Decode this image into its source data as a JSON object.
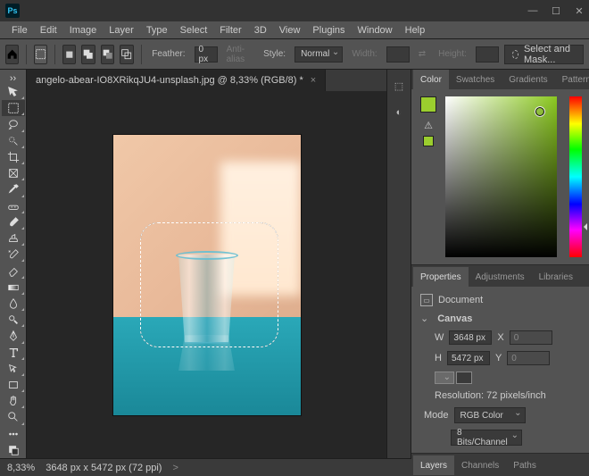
{
  "menubar": [
    "File",
    "Edit",
    "Image",
    "Layer",
    "Type",
    "Select",
    "Filter",
    "3D",
    "View",
    "Plugins",
    "Window",
    "Help"
  ],
  "optbar": {
    "feather_label": "Feather:",
    "feather_value": "0 px",
    "antialias": "Anti-alias",
    "style_label": "Style:",
    "style_value": "Normal",
    "width_label": "Width:",
    "height_label": "Height:",
    "mask_button": "Select and Mask..."
  },
  "tab": {
    "title": "angelo-abear-IO8XRikqJU4-unsplash.jpg @ 8,33% (RGB/8) *",
    "close": "×"
  },
  "panels": {
    "color_tabs": [
      "Color",
      "Swatches",
      "Gradients",
      "Patterns"
    ],
    "prop_tabs": [
      "Properties",
      "Adjustments",
      "Libraries"
    ],
    "layer_tabs": [
      "Layers",
      "Channels",
      "Paths"
    ]
  },
  "properties": {
    "document_label": "Document",
    "canvas_label": "Canvas",
    "w_label": "W",
    "w_value": "3648 px",
    "h_label": "H",
    "h_value": "5472 px",
    "x_label": "X",
    "x_value": "0",
    "y_label": "Y",
    "y_value": "0",
    "resolution": "Resolution: 72 pixels/inch",
    "mode_label": "Mode",
    "mode_value": "RGB Color",
    "depth_value": "8 Bits/Channel"
  },
  "statusbar": {
    "zoom": "8,33%",
    "info": "3648 px x 5472 px (72 ppi)",
    "arrow": ">"
  },
  "tools": [
    "move-tool",
    "rectangular-marquee-tool",
    "lasso-tool",
    "quick-select-tool",
    "crop-tool",
    "frame-tool",
    "eyedropper-tool",
    "spot-heal-tool",
    "brush-tool",
    "clone-stamp-tool",
    "history-brush-tool",
    "eraser-tool",
    "gradient-tool",
    "blur-tool",
    "dodge-tool",
    "pen-tool",
    "type-tool",
    "path-select-tool",
    "rectangle-tool",
    "hand-tool",
    "zoom-tool",
    "edit-toolbar",
    "foreground-background"
  ]
}
